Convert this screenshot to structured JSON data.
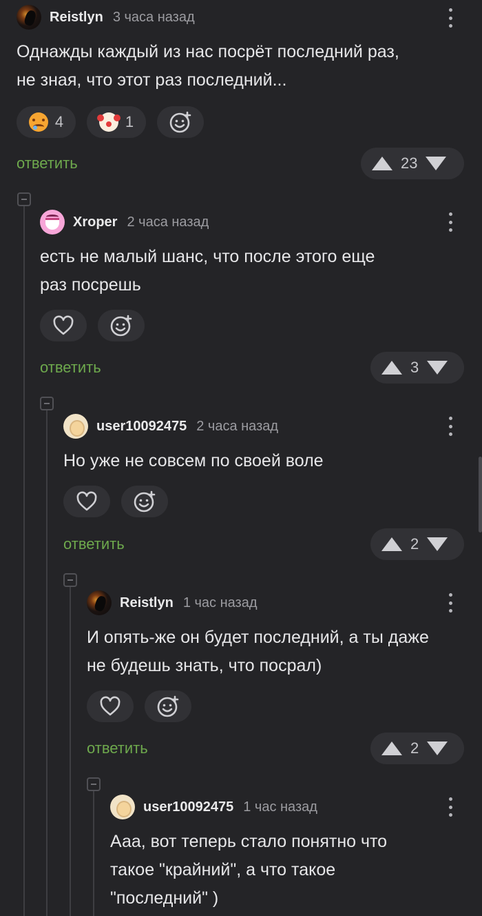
{
  "comments": [
    {
      "author": "Reistlyn",
      "time": "3 часа назад",
      "text_lines": [
        "Однажды каждый из нас посрёт последний раз,",
        "не зная, что этот раз последний..."
      ],
      "reactions": [
        {
          "emoji": "sad-sweat-emoji",
          "count": "4"
        },
        {
          "emoji": "clown-emoji",
          "count": "1"
        }
      ],
      "reply_label": "ответить",
      "votes": "23"
    },
    {
      "author": "Xroper",
      "time": "2 часа назад",
      "text_lines": [
        "есть не малый шанс, что после этого еще",
        "раз посрешь"
      ],
      "reply_label": "ответить",
      "votes": "3"
    },
    {
      "author": "user10092475",
      "time": "2 часа назад",
      "text_lines": [
        "Но уже не совсем по своей воле"
      ],
      "reply_label": "ответить",
      "votes": "2"
    },
    {
      "author": "Reistlyn",
      "time": "1 час назад",
      "text_lines": [
        "И опять-же он будет последний, а ты даже",
        "не будешь знать, что посрал)"
      ],
      "reply_label": "ответить",
      "votes": "2"
    },
    {
      "author": "user10092475",
      "time": "1 час назад",
      "text_lines": [
        "Ааа, вот теперь стало понятно что",
        "такое \"крайний\", а что такое",
        "\"последний\" )"
      ]
    }
  ],
  "colors": {
    "background": "#242427",
    "reply_link": "#6ea94d",
    "pill": "#313135"
  },
  "icons": [
    "kebab-menu-icon",
    "heart-icon",
    "add-reaction-icon",
    "upvote-icon",
    "downvote-icon",
    "collapse-thread-icon"
  ]
}
